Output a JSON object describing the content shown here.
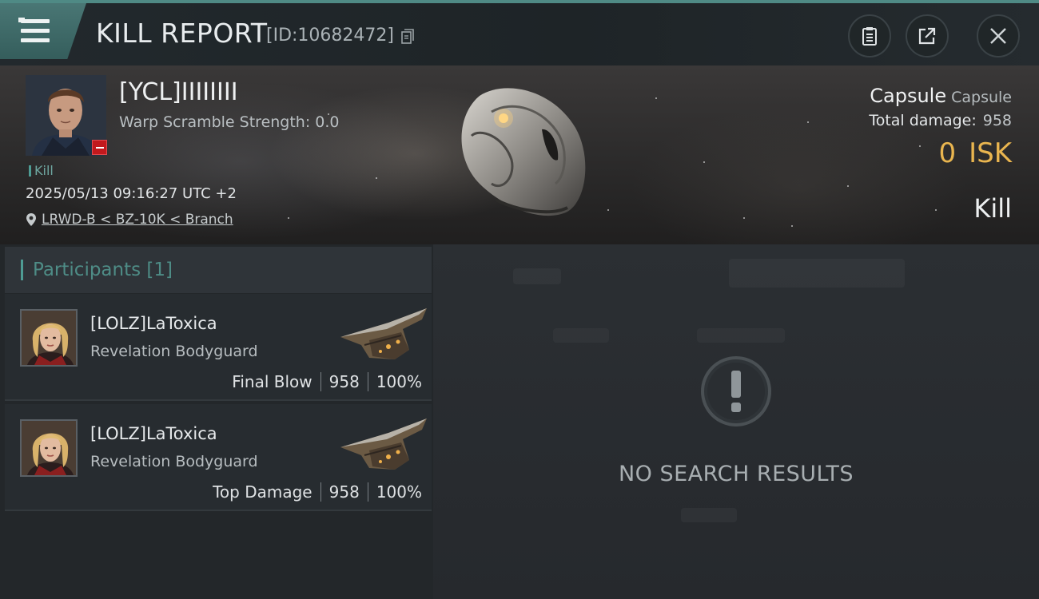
{
  "header": {
    "title": "KILL REPORT",
    "report_id": "[ID:10682472]"
  },
  "victim": {
    "name": "[YCL]IIIIIIII",
    "warp_scramble": "Warp Scramble Strength: 0.0",
    "kill_tag": "Kill",
    "datetime": "2025/05/13 09:16:27 UTC +2",
    "location": "LRWD-B < BZ-10K < Branch",
    "ship_name": "Capsule",
    "ship_class": "Capsule",
    "total_damage_label": "Total damage:",
    "total_damage": "958",
    "isk_value": "0",
    "isk_unit": "ISK",
    "result": "Kill"
  },
  "participants": {
    "label": "Participants [1]",
    "rows": [
      {
        "name": "[LOLZ]LaToxica",
        "ship": "Revelation Bodyguard",
        "role": "Final Blow",
        "damage": "958",
        "percent": "100%"
      },
      {
        "name": "[LOLZ]LaToxica",
        "ship": "Revelation Bodyguard",
        "role": "Top Damage",
        "damage": "958",
        "percent": "100%"
      }
    ]
  },
  "results": {
    "empty_text": "NO SEARCH RESULTS"
  },
  "colors": {
    "accent": "#4e9c94",
    "isk": "#e9b54f",
    "badge": "#c2191d"
  },
  "icons": [
    "hamburger-icon",
    "copy-icon",
    "clipboard-icon",
    "share-icon",
    "close-icon",
    "location-pin-icon",
    "warning-icon"
  ]
}
